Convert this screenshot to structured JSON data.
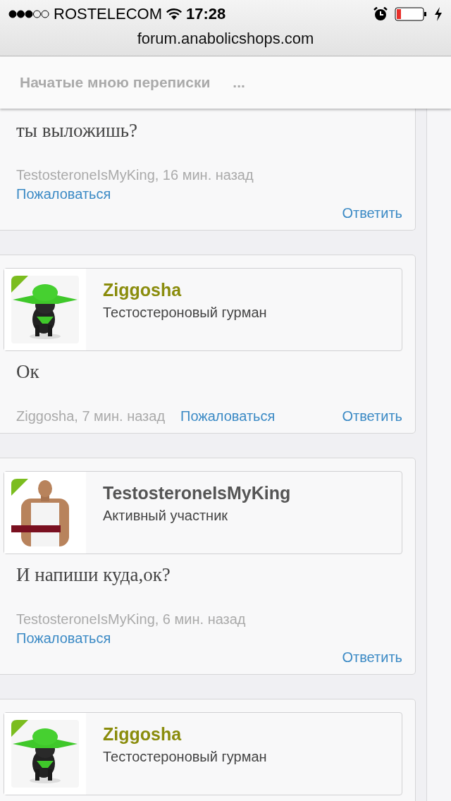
{
  "status_bar": {
    "carrier": "ROSTELECOM",
    "time": "17:28"
  },
  "browser": {
    "url": "forum.anabolicshops.com"
  },
  "header": {
    "title": "Начатые мною переписки",
    "more": "..."
  },
  "posts": [
    {
      "message": "ты выложишь?",
      "author_time": "TestosteroneIsMyKing, 16 мин. назад",
      "report": "Пожаловаться",
      "reply": "Ответить"
    },
    {
      "user": {
        "name": "Ziggosha",
        "title": "Тестостероновый гурман",
        "color": "#8a8c0c"
      },
      "message": "Ок",
      "author_time": "Ziggosha, 7 мин. назад",
      "report": "Пожаловаться",
      "reply": "Ответить"
    },
    {
      "user": {
        "name": "TestosteroneIsMyKing",
        "title": "Активный участник",
        "color": "#555555"
      },
      "message": "И напиши куда,ок?",
      "author_time": "TestosteroneIsMyKing, 6 мин. назад",
      "report": "Пожаловаться",
      "reply": "Ответить"
    },
    {
      "user": {
        "name": "Ziggosha",
        "title": "Тестостероновый гурман",
        "color": "#8a8c0c"
      }
    }
  ]
}
